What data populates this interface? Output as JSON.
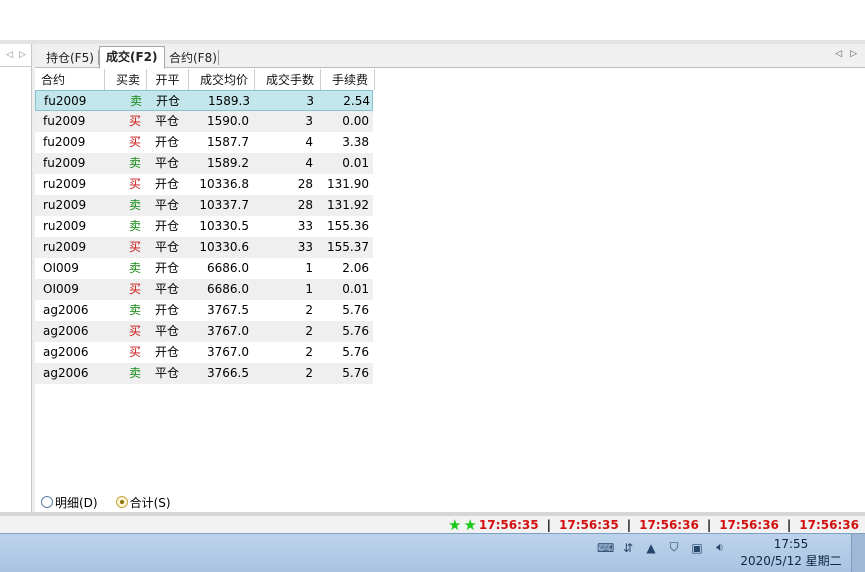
{
  "left_panel": {
    "nav_prev": "◁",
    "nav_next": "▷"
  },
  "tabs": [
    {
      "label": "持仓(F5)"
    },
    {
      "label": "成交(F2)"
    },
    {
      "label": "合约(F8)"
    }
  ],
  "tab_nav": {
    "prev": "◁",
    "next": "▷"
  },
  "table": {
    "columns": [
      "合约",
      "买卖",
      "开平",
      "成交均价",
      "成交手数",
      "手续费"
    ],
    "rows": [
      {
        "contract": "fu2009",
        "side": "卖",
        "open_close": "开仓",
        "price": "1589.3",
        "lots": "3",
        "fee": "2.54"
      },
      {
        "contract": "fu2009",
        "side": "买",
        "open_close": "平仓",
        "price": "1590.0",
        "lots": "3",
        "fee": "0.00"
      },
      {
        "contract": "fu2009",
        "side": "买",
        "open_close": "开仓",
        "price": "1587.7",
        "lots": "4",
        "fee": "3.38"
      },
      {
        "contract": "fu2009",
        "side": "卖",
        "open_close": "平仓",
        "price": "1589.2",
        "lots": "4",
        "fee": "0.01"
      },
      {
        "contract": "ru2009",
        "side": "买",
        "open_close": "开仓",
        "price": "10336.8",
        "lots": "28",
        "fee": "131.90"
      },
      {
        "contract": "ru2009",
        "side": "卖",
        "open_close": "平仓",
        "price": "10337.7",
        "lots": "28",
        "fee": "131.92"
      },
      {
        "contract": "ru2009",
        "side": "卖",
        "open_close": "开仓",
        "price": "10330.5",
        "lots": "33",
        "fee": "155.36"
      },
      {
        "contract": "ru2009",
        "side": "买",
        "open_close": "平仓",
        "price": "10330.6",
        "lots": "33",
        "fee": "155.37"
      },
      {
        "contract": "OI009",
        "side": "卖",
        "open_close": "开仓",
        "price": "6686.0",
        "lots": "1",
        "fee": "2.06"
      },
      {
        "contract": "OI009",
        "side": "买",
        "open_close": "平仓",
        "price": "6686.0",
        "lots": "1",
        "fee": "0.01"
      },
      {
        "contract": "ag2006",
        "side": "卖",
        "open_close": "开仓",
        "price": "3767.5",
        "lots": "2",
        "fee": "5.76"
      },
      {
        "contract": "ag2006",
        "side": "买",
        "open_close": "平仓",
        "price": "3767.0",
        "lots": "2",
        "fee": "5.76"
      },
      {
        "contract": "ag2006",
        "side": "买",
        "open_close": "开仓",
        "price": "3767.0",
        "lots": "2",
        "fee": "5.76"
      },
      {
        "contract": "ag2006",
        "side": "卖",
        "open_close": "平仓",
        "price": "3766.5",
        "lots": "2",
        "fee": "5.76"
      }
    ]
  },
  "radios": {
    "detail": "明细(D)",
    "total": "合计(S)"
  },
  "statusbar": {
    "times": [
      "17:56:35",
      "17:56:35",
      "17:56:36",
      "17:56:36",
      "17:56:36"
    ],
    "separator": "|"
  },
  "taskbar": {
    "time": "17:55",
    "date": "2020/5/12 星期二"
  },
  "colors": {
    "buy": "#cc1111",
    "sell": "#118811",
    "clock": "#d40f0f",
    "selected_row": "#c3e6ec"
  }
}
